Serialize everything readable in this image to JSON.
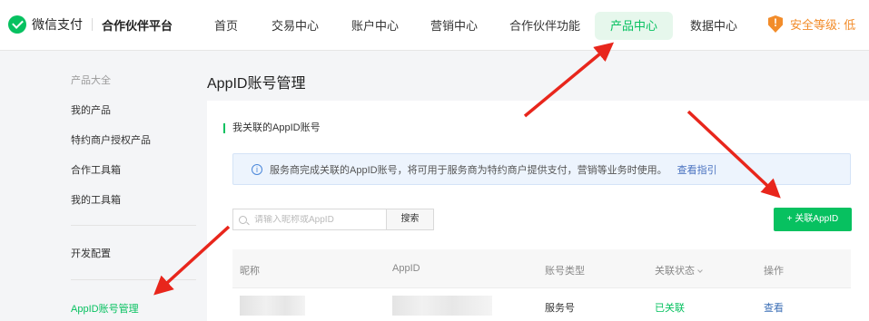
{
  "header": {
    "brand": "微信支付",
    "platform": "合作伙伴平台",
    "nav": [
      {
        "label": "首页"
      },
      {
        "label": "交易中心"
      },
      {
        "label": "账户中心"
      },
      {
        "label": "营销中心"
      },
      {
        "label": "合作伙伴功能"
      },
      {
        "label": "产品中心",
        "active": true
      },
      {
        "label": "数据中心"
      }
    ],
    "security_label": "安全等级: 低"
  },
  "sidebar": {
    "heading": "产品大全",
    "items": [
      "我的产品",
      "特约商户授权产品",
      "合作工具箱",
      "我的工具箱"
    ],
    "dev_config": "开发配置",
    "active_item": "AppID账号管理"
  },
  "main": {
    "page_title": "AppID账号管理",
    "section_title": "我关联的AppID账号",
    "notice_text": "服务商完成关联的AppID账号，将可用于服务商为特约商户提供支付，营销等业务时使用。",
    "notice_link": "查看指引",
    "search_placeholder": "请输入昵称或AppID",
    "search_button": "搜索",
    "add_button": "+ 关联AppID",
    "table": {
      "headers": [
        "昵称",
        "AppID",
        "账号类型",
        "关联状态",
        "操作"
      ],
      "rows": [
        {
          "nickname": "",
          "appid": "",
          "type": "服务号",
          "status": "已关联",
          "action": "查看"
        }
      ]
    }
  },
  "colors": {
    "brand_green": "#07c160",
    "warning_orange": "#f28c2a",
    "annotation_red": "#e8261c",
    "link_blue": "#3c6fb6"
  }
}
